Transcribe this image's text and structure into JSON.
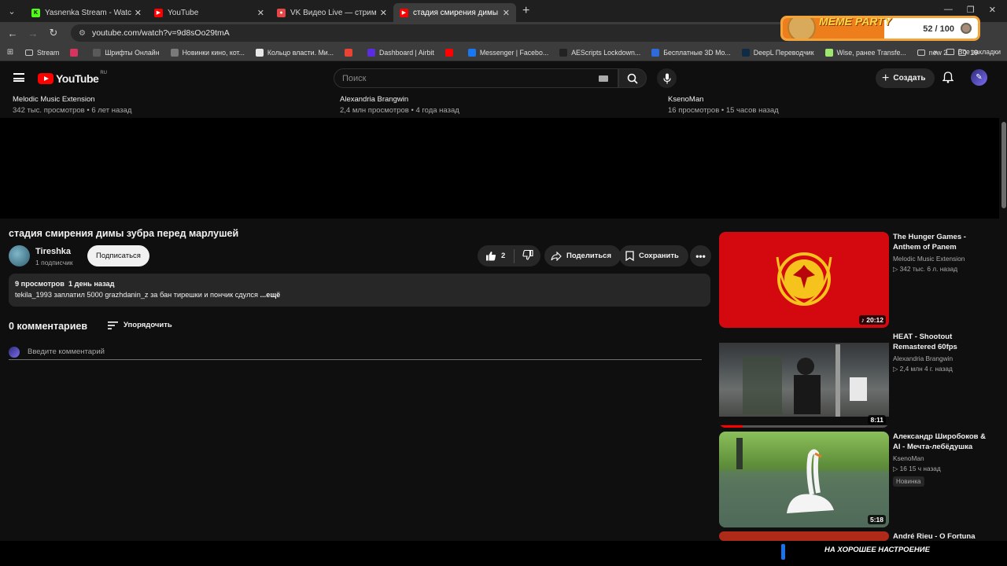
{
  "browser": {
    "tabs": [
      {
        "title": "Yasnenka Stream - Watch Live o",
        "icon_color": "#53fc18",
        "active": false
      },
      {
        "title": "YouTube",
        "icon_color": "#ff0000",
        "active": false
      },
      {
        "title": "VK Видео Live — стримы, пря",
        "icon_color": "#e64646",
        "active": false
      },
      {
        "title": "стадия смирения димы зубра",
        "icon_color": "#ff0000",
        "active": true
      }
    ],
    "url": "youtube.com/watch?v=9d8sOo29tmA",
    "bookmarks": [
      {
        "label": "Stream",
        "icon": "folder-icon",
        "color": "#c9c9c9"
      },
      {
        "label": "",
        "icon": "live-icon",
        "color": "#d8345f"
      },
      {
        "label": "Шрифты Онлайн",
        "icon": "font-icon",
        "color": "#5a5a5a"
      },
      {
        "label": "Новинки кино, кот...",
        "icon": "film-icon",
        "color": "#7a7a7a"
      },
      {
        "label": "Кольцо власти. Ми...",
        "icon": "r-icon",
        "color": "#e8e8e8"
      },
      {
        "label": "",
        "icon": "gmail-icon",
        "color": "#ea4335"
      },
      {
        "label": "Dashboard | Airbit",
        "icon": "airbit-icon",
        "color": "#5a2ee0"
      },
      {
        "label": "",
        "icon": "youtube-icon",
        "color": "#ff0000"
      },
      {
        "label": "Messenger | Facebo...",
        "icon": "facebook-icon",
        "color": "#1877f2"
      },
      {
        "label": "AEScripts Lockdown...",
        "icon": "tiktok-icon",
        "color": "#222222"
      },
      {
        "label": "Бесплатные 3D Мо...",
        "icon": "3d-icon",
        "color": "#2e6bd8"
      },
      {
        "label": "DeepL Переводчик",
        "icon": "deepl-icon",
        "color": "#0f2b46"
      },
      {
        "label": "Wise, ранее Transfe...",
        "icon": "wise-icon",
        "color": "#9fe870"
      },
      {
        "label": "new 2",
        "icon": "folder-icon",
        "color": "#c9c9c9"
      },
      {
        "label": "19",
        "icon": "folder-icon",
        "color": "#c9c9c9"
      }
    ],
    "all_bookmarks": "Все закладки"
  },
  "overlay": {
    "title": "MEME PARTY",
    "count": "52 / 100",
    "progress": 0.52,
    "bottom_text": "НА ХОРОШЕЕ НАСТРОЕНИЕ"
  },
  "masthead": {
    "logo": "YouTube",
    "country": "RU",
    "search_placeholder": "Поиск",
    "create": "Создать"
  },
  "top_row": [
    {
      "channel": "Melodic Music Extension",
      "stats": "342 тыс. просмотров • 6 лет назад"
    },
    {
      "channel": "Alexandria Brangwin",
      "stats": "2,4 млн просмотров • 4 года назад"
    },
    {
      "channel": "KsenoMan",
      "stats": "16 просмотров • 15 часов назад"
    }
  ],
  "video": {
    "title": "стадия смирения димы зубра перед марлушей",
    "channel": "Tireshka",
    "subscribers": "1 подписчик",
    "subscribe": "Подписаться",
    "likes": "2",
    "share": "Поделиться",
    "save": "Сохранить",
    "views": "9 просмотров",
    "date": "1 день назад",
    "description": "tekila_1993 заплатил 5000 grazhdanin_z за бан тирешки и пончик сдулся",
    "more": "...ещё"
  },
  "comments": {
    "heading": "0 комментариев",
    "sort": "Упорядочить",
    "placeholder": "Введите комментарий"
  },
  "sidebar": [
    {
      "title": "The Hunger Games - Anthem of Panem",
      "channel": "Melodic Music Extension",
      "stats": "▷ 342 тыс.   6 л. назад",
      "duration": "♪ 20:12",
      "badge": ""
    },
    {
      "title": "HEAT - Shootout Remastered 60fps",
      "channel": "Alexandria Brangwin",
      "stats": "▷ 2,4 млн   4 г. назад",
      "duration": "8:11",
      "badge": ""
    },
    {
      "title": "Александр Широбоков & AI - Мечта-лебёдушка",
      "channel": "KsenoMan",
      "stats": "▷ 16   15 ч назад",
      "duration": "5:18",
      "badge": "Новинка"
    },
    {
      "title": "André Rieu - O Fortuna",
      "channel": "",
      "stats": "",
      "duration": "",
      "badge": ""
    }
  ]
}
